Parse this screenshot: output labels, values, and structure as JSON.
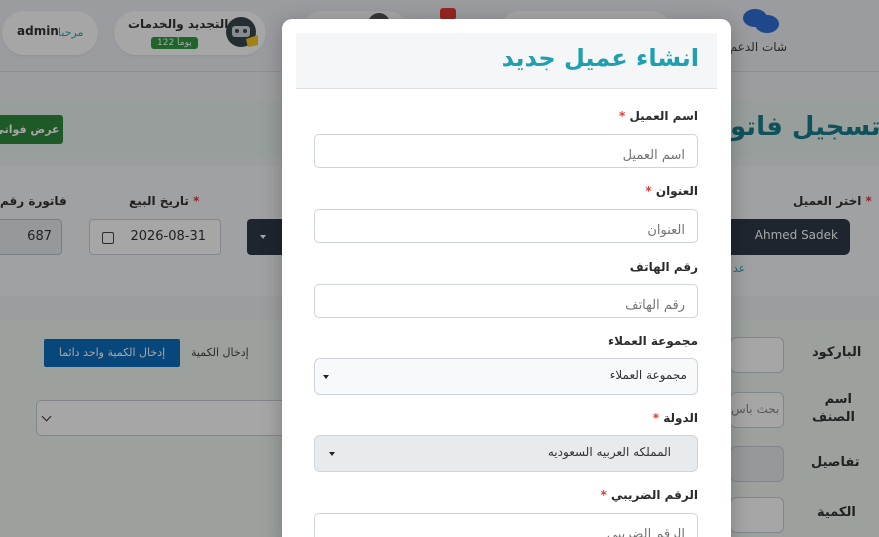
{
  "topbar": {
    "admin": {
      "greeting": "مرحبا",
      "name": "admin"
    },
    "renewal": {
      "title": "التجديد والخدمات",
      "badge": "122 يوماً"
    },
    "support_chat": "شات الدعم"
  },
  "page": {
    "title": "تسجيل فاتو",
    "show_invoices_button": "عرض فواتي",
    "invoice_number_label": "فاتورة رقم",
    "invoice_number_value": "687",
    "sale_date_label": "تاريخ البيع",
    "sale_date_value": "2026-08-31",
    "customer_label": "اختر العميل",
    "customer_value": "Ahmed Sadek",
    "customer_link": "عد",
    "barcode_label": "الباركود",
    "item_name_label": "اسم\nالصنف",
    "item_search_placeholder": "بحث باس",
    "details_label": "تفاصيل",
    "quantity_label": "الكمية",
    "enter_qty_one_button": "إدخال الكمية واحد دائما",
    "enter_qty_label": "إدخال الكمية"
  },
  "modal": {
    "title": "انشاء عميل جديد",
    "fields": {
      "name": {
        "label": "اسم العميل",
        "placeholder": "اسم العميل",
        "required": true
      },
      "address": {
        "label": "العنوان",
        "placeholder": "العنوان",
        "required": true
      },
      "phone": {
        "label": "رقم الهاتف",
        "placeholder": "رقم الهاتف",
        "required": false
      },
      "group": {
        "label": "مجموعة العملاء",
        "value": "مجموعة العملاء"
      },
      "country": {
        "label": "الدولة",
        "value": "المملكه العربيه السعوديه",
        "required": true
      },
      "tax_number": {
        "label": "الرقم الضريبي",
        "placeholder": "الرقم الضريبي",
        "required": true
      }
    },
    "required_mark": "*"
  }
}
